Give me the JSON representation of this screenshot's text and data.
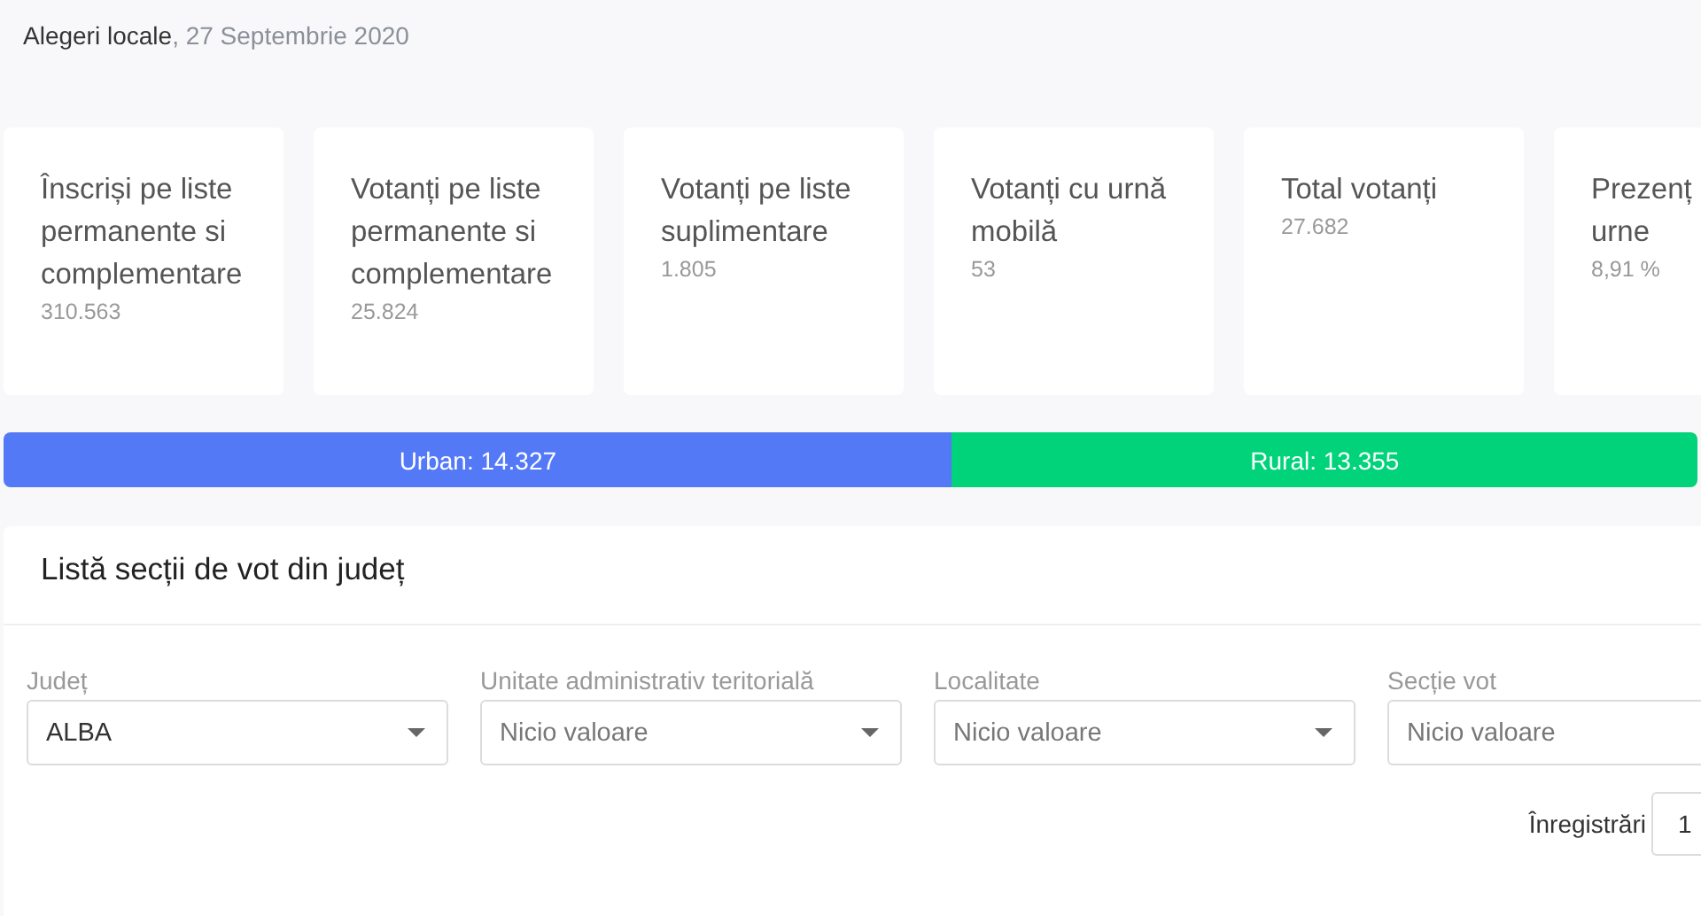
{
  "header": {
    "title": "Alegeri locale",
    "date": ", 27 Septembrie 2020"
  },
  "cards": [
    {
      "title_lines": [
        "Înscriși pe liste",
        "permanente si",
        "complementare"
      ],
      "value": "310.563"
    },
    {
      "title_lines": [
        "Votanți pe liste",
        "permanente si",
        "complementare"
      ],
      "value": "25.824"
    },
    {
      "title_lines": [
        "Votanți pe liste",
        "suplimentare"
      ],
      "value": "1.805"
    },
    {
      "title_lines": [
        "Votanți cu urnă",
        "mobilă"
      ],
      "value": "53"
    },
    {
      "title_lines": [
        "Total votanți"
      ],
      "value": "27.682"
    },
    {
      "title_lines": [
        "Prezenț",
        "urne"
      ],
      "value": "8,91 %"
    }
  ],
  "split_bar": [
    {
      "label": "Urban: 14.327",
      "level": 0.56,
      "color": "#5479f7"
    },
    {
      "label": "Rural: 13.355",
      "level": 0.44,
      "color": "#00d37a"
    }
  ],
  "panel": {
    "title": "Listă secții de vot din județ",
    "filters": [
      {
        "label": "Județ",
        "value": "ALBA"
      },
      {
        "label": "Unitate administrativ teritorială",
        "placeholder": "Nicio valoare"
      },
      {
        "label": "Localitate",
        "placeholder": "Nicio valoare"
      },
      {
        "label": "Secție vot",
        "placeholder": "Nicio valoare"
      }
    ],
    "entries": {
      "label": "Înregistrări",
      "value": "1"
    }
  }
}
